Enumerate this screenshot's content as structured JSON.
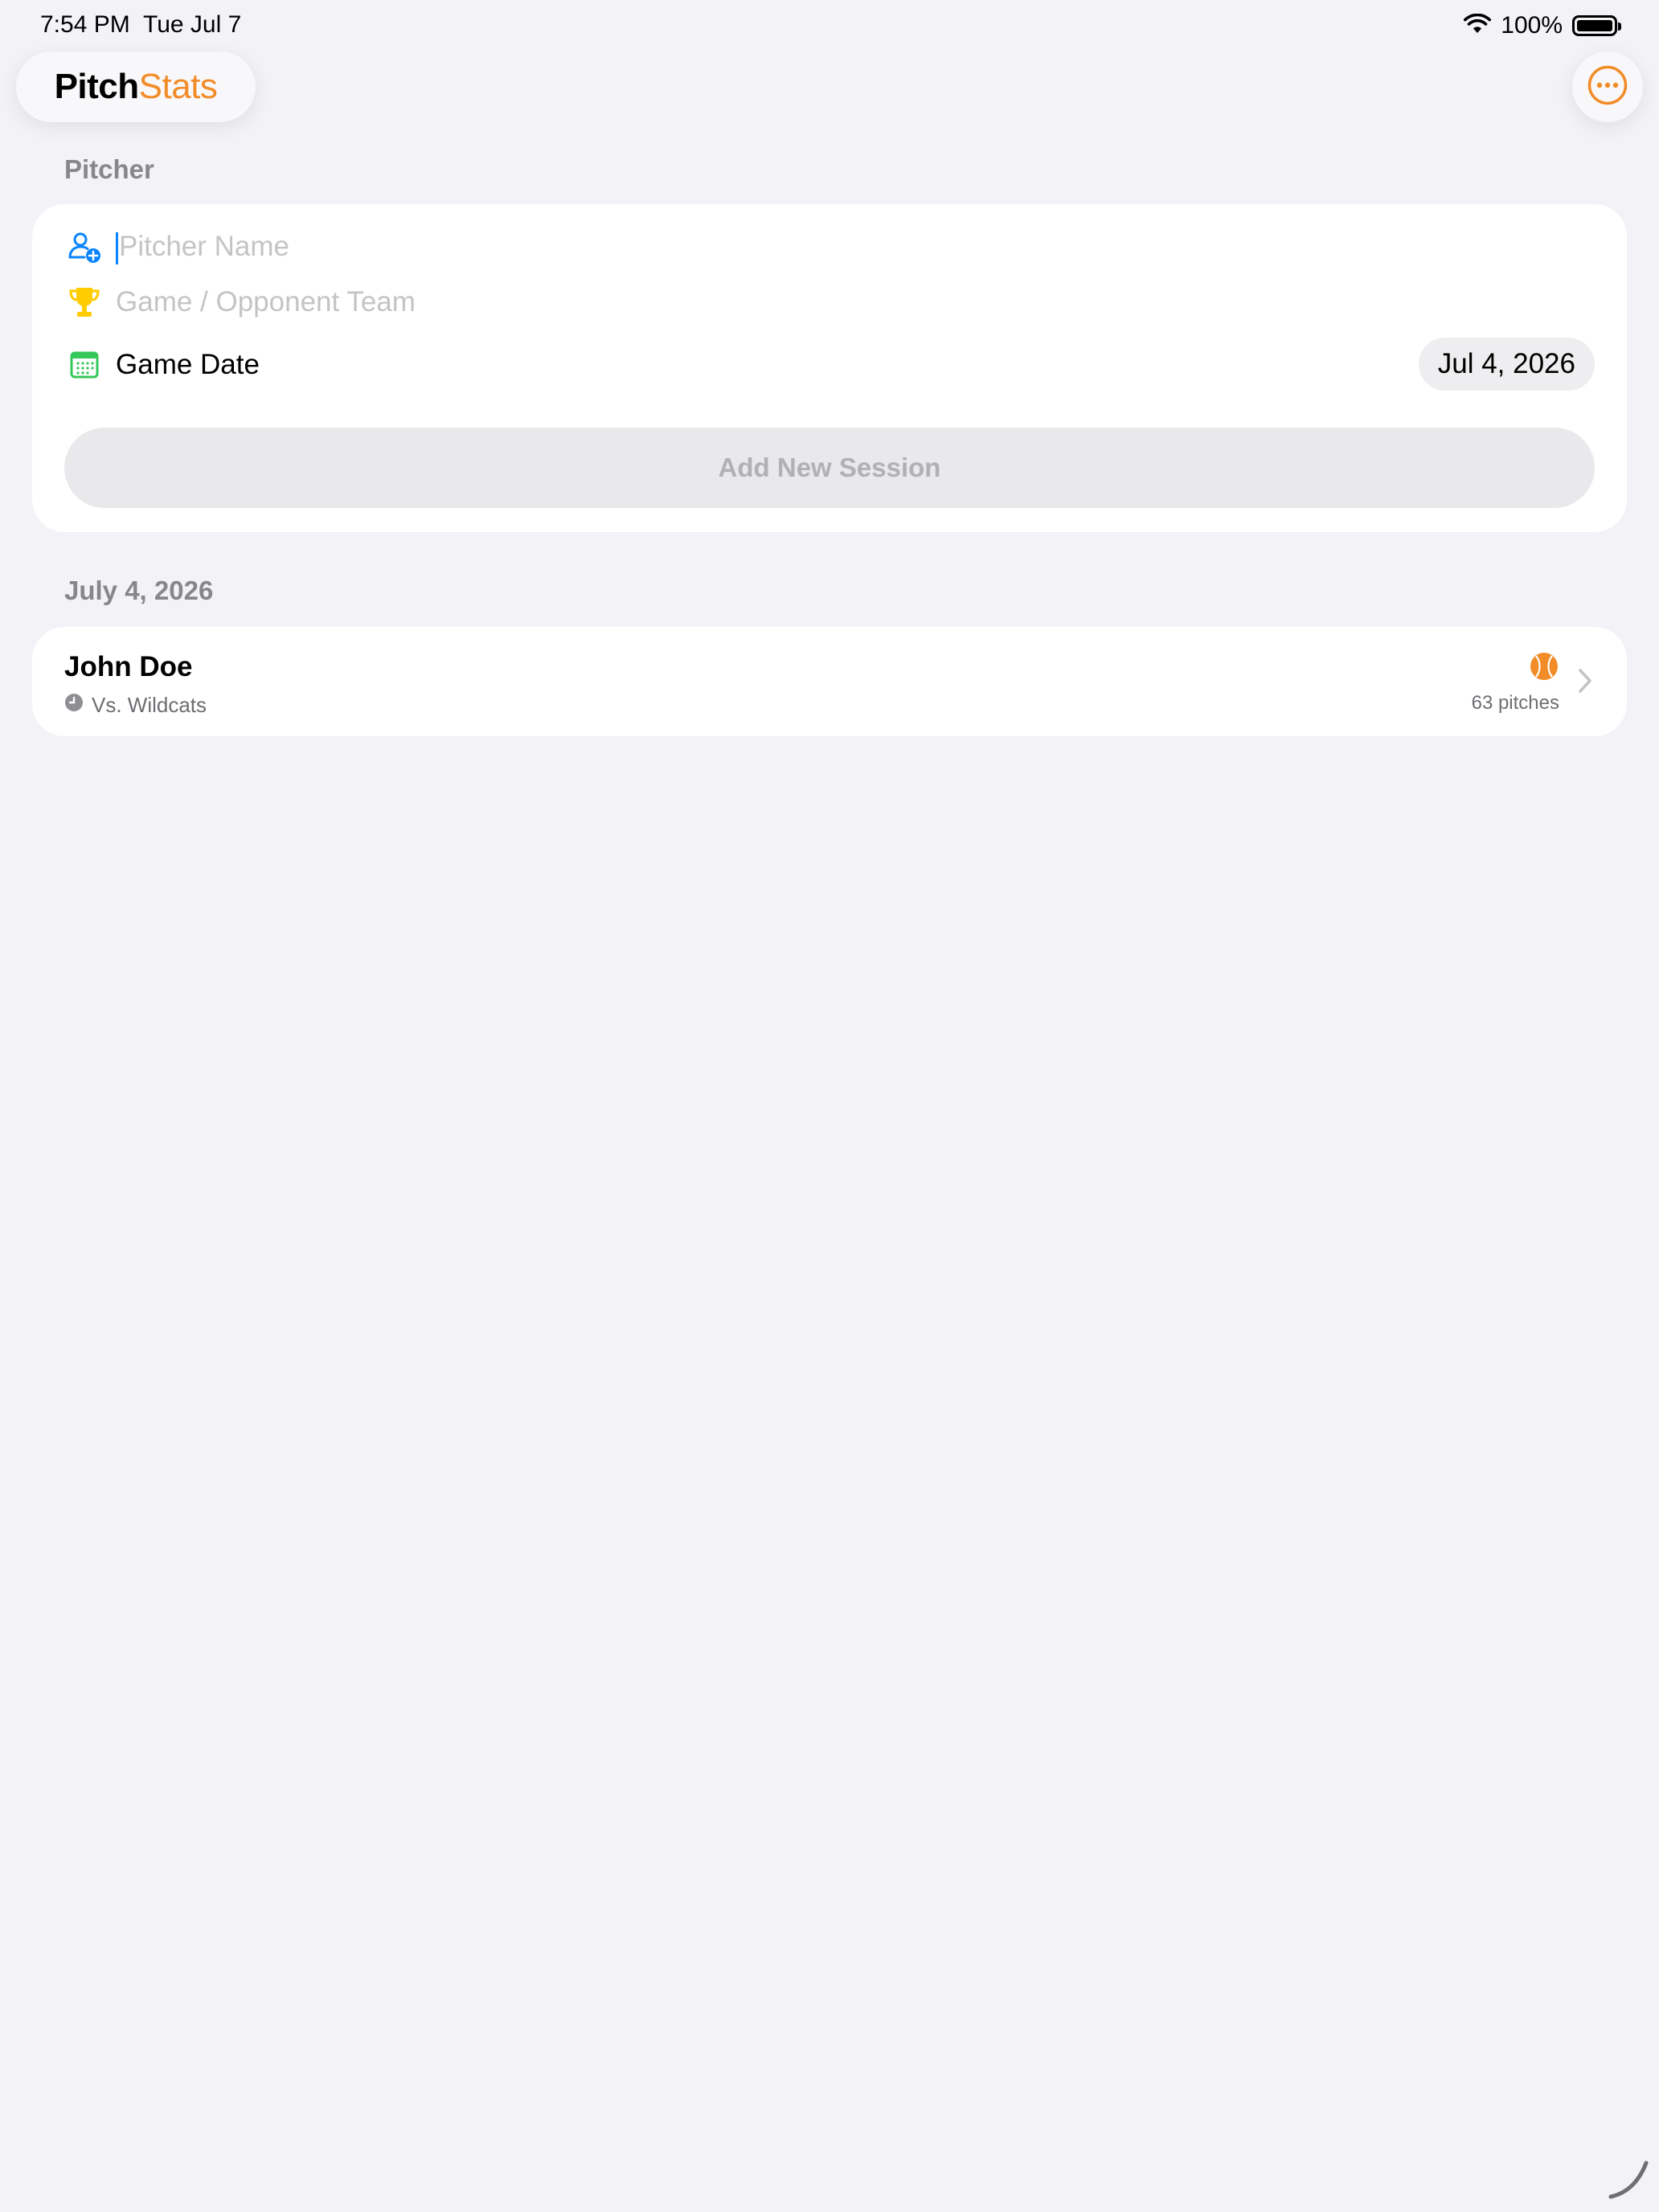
{
  "status_bar": {
    "time": "7:54 PM",
    "date": "Tue Jul 7",
    "battery_percent": "100%",
    "battery_level": 1.0
  },
  "app": {
    "logo_bold": "Pitch",
    "logo_light": "Stats",
    "accent_color": "#f28c28",
    "more_icon": "ellipsis-circle-icon"
  },
  "pitcher_section": {
    "header": "Pitcher",
    "name_placeholder": "Pitcher Name",
    "name_value": "",
    "team_placeholder": "Game / Opponent Team",
    "team_value": "",
    "date_label": "Game Date",
    "date_value": "Jul 4, 2026",
    "add_button_label": "Add New Session",
    "icons": {
      "name": "person-add-icon",
      "team": "trophy-icon",
      "date": "calendar-icon"
    }
  },
  "sessions": {
    "date_header": "July 4, 2026",
    "items": [
      {
        "name": "John Doe",
        "opponent": "Vs. Wildcats",
        "pitch_count": "63 pitches"
      }
    ]
  }
}
